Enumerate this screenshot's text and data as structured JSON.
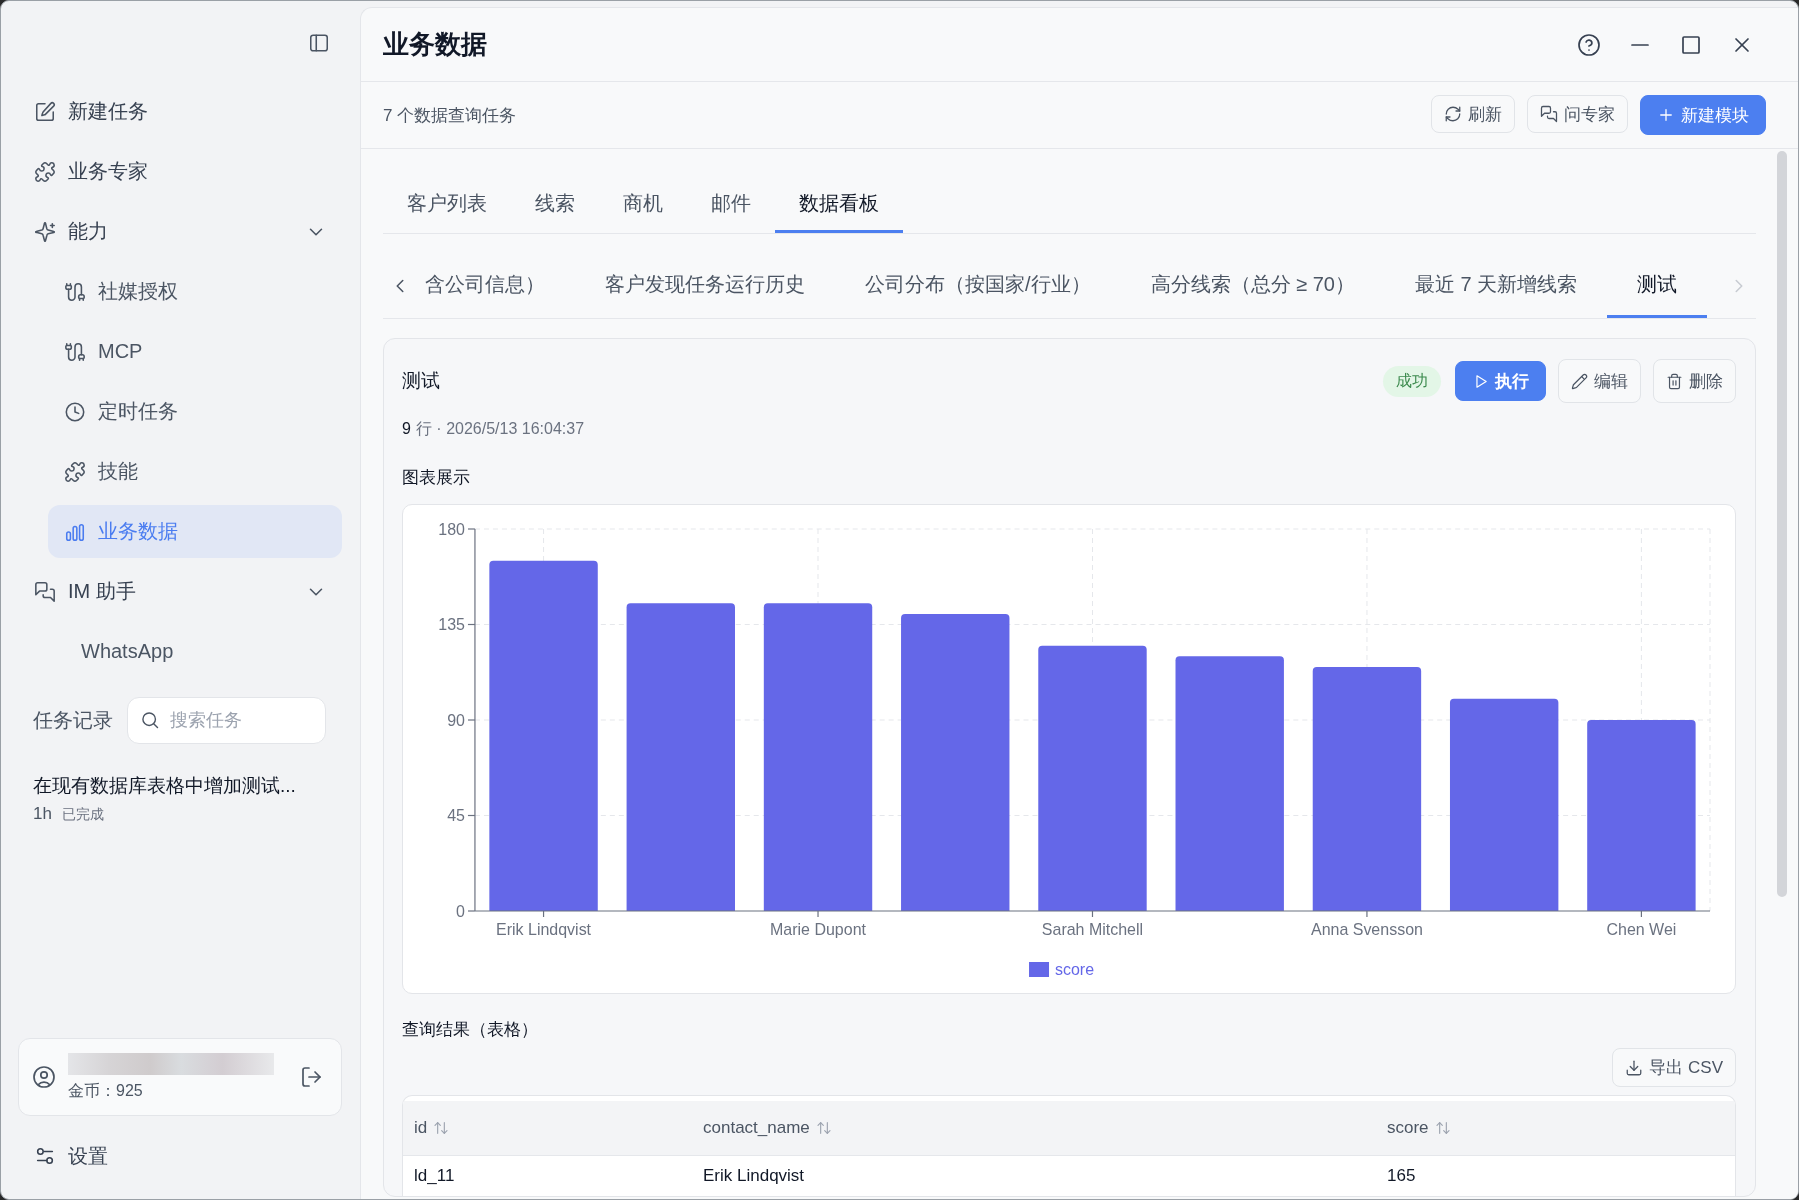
{
  "sidebar": {
    "nav": [
      {
        "label": "新建任务",
        "selected": false
      },
      {
        "label": "业务专家",
        "selected": false
      },
      {
        "label": "能力",
        "selected": false,
        "expanded": true,
        "children": [
          {
            "label": "社媒授权",
            "selected": false
          },
          {
            "label": "MCP",
            "selected": false
          },
          {
            "label": "定时任务",
            "selected": false
          },
          {
            "label": "技能",
            "selected": false
          },
          {
            "label": "业务数据",
            "selected": true
          }
        ]
      },
      {
        "label": "IM 助手",
        "selected": false,
        "expanded": true,
        "children": [
          {
            "label": "WhatsApp",
            "selected": false
          }
        ]
      }
    ],
    "history": {
      "label": "任务记录",
      "search": {
        "placeholder": "搜索任务"
      },
      "tasks": [
        {
          "title": "在现有数据库表格中增加测试...",
          "age": "1h",
          "status": "已完成"
        }
      ]
    },
    "account": {
      "coins": "金币：925"
    },
    "settings": {
      "label": "设置"
    }
  },
  "header": {
    "title": "业务数据"
  },
  "toolbar": {
    "summary": "7 个数据查询任务",
    "buttons": [
      {
        "label": "刷新",
        "kind": "secondary"
      },
      {
        "label": "问专家",
        "kind": "secondary"
      },
      {
        "label": "新建模块",
        "kind": "primary"
      }
    ]
  },
  "tabs": [
    {
      "label": "客户列表",
      "selected": false
    },
    {
      "label": "线索",
      "selected": false
    },
    {
      "label": "商机",
      "selected": false
    },
    {
      "label": "邮件",
      "selected": false
    },
    {
      "label": "数据看板",
      "selected": true
    }
  ],
  "subtabs": {
    "scroll_left": {
      "disabled": false
    },
    "scroll_right": {
      "disabled": true
    },
    "items": [
      {
        "label": "含公司信息）",
        "selected": false
      },
      {
        "label": "客户发现任务运行历史",
        "selected": false
      },
      {
        "label": "公司分布（按国家/行业）",
        "selected": false
      },
      {
        "label": "高分线索（总分 ≥ 70）",
        "selected": false
      },
      {
        "label": "最近 7 天新增线索",
        "selected": false
      },
      {
        "label": "测试",
        "selected": true
      }
    ]
  },
  "card": {
    "title": "测试",
    "status": {
      "label": "成功",
      "kind": "success"
    },
    "actions": [
      {
        "label": "执行",
        "kind": "primary"
      },
      {
        "label": "编辑",
        "kind": "secondary"
      },
      {
        "label": "删除",
        "kind": "secondary"
      }
    ],
    "row_count": "9",
    "meta": "行 · 2026/5/13 16:04:37",
    "chart_title": "图表展示",
    "chart_data": {
      "type": "bar",
      "categories": [
        "Erik Lindqvist",
        null,
        "Marie Dupont",
        null,
        "Sarah Mitchell",
        null,
        "Anna Svensson",
        null,
        "Chen Wei"
      ],
      "series": [
        {
          "name": "score",
          "color": "#6467e8",
          "values": [
            165,
            145,
            145,
            140,
            125,
            120,
            115,
            100,
            90
          ]
        }
      ],
      "ylim": [
        0,
        180
      ],
      "yticks": [
        0,
        45,
        90,
        135,
        180
      ],
      "grid": true
    },
    "table_title": "查询结果（表格）",
    "export_button": "导出 CSV",
    "table": {
      "columns": [
        "id",
        "contact_name",
        "score"
      ],
      "rows": [
        [
          "ld_11",
          "Erik Lindqvist",
          "165"
        ]
      ]
    }
  }
}
